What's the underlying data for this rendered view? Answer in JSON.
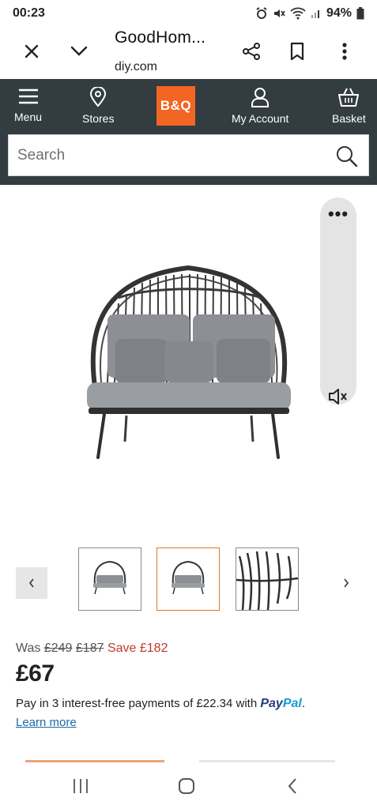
{
  "status_bar": {
    "time": "00:23",
    "battery": "94%"
  },
  "browser": {
    "title": "GoodHom...",
    "domain": "diy.com"
  },
  "site_nav": {
    "items": [
      {
        "label": "Menu",
        "icon": "menu-icon"
      },
      {
        "label": "Stores",
        "icon": "location-pin-icon"
      },
      {
        "label": "My Account",
        "icon": "user-icon"
      },
      {
        "label": "Basket",
        "icon": "basket-icon"
      }
    ],
    "logo_text": "B&Q",
    "brand_color": "#f26522",
    "bar_color": "#333c40"
  },
  "search": {
    "placeholder": "Search"
  },
  "gallery": {
    "thumbnail_count": 3,
    "active_index": 1,
    "active_color": "#e0762b"
  },
  "price": {
    "was_label": "Was",
    "was_price_1": "£249",
    "was_price_2": "£187",
    "save_text": "Save £182",
    "current": "£67",
    "paypal_text": "Pay in 3 interest-free payments of £22.34 with",
    "paypal_brand_a": "Pay",
    "paypal_brand_b": "Pal",
    "paypal_suffix": ".",
    "learn_more": "Learn more"
  }
}
